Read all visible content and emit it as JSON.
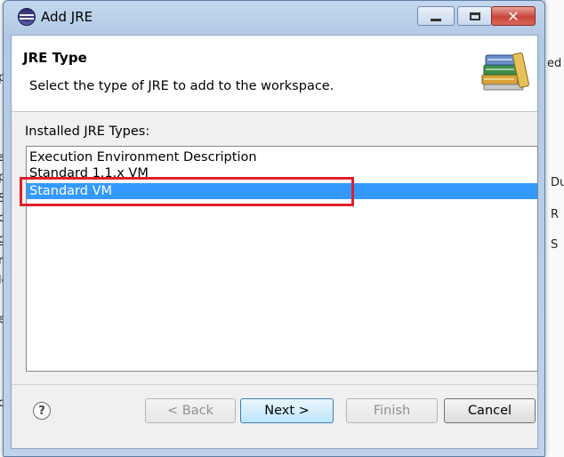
{
  "window": {
    "title": "Add JRE",
    "minimize_label": "",
    "maximize_label": "",
    "close_label": "✕"
  },
  "background": {
    "behind_title": "Installed JREs",
    "left_fragments": [
      "a",
      "p",
      "pl",
      "S",
      "oi",
      "g",
      "r",
      "le",
      "er",
      "o"
    ],
    "right_fragments": [
      "ed",
      "Du",
      "R",
      "S"
    ]
  },
  "header": {
    "title": "JRE Type",
    "description": "Select the type of JRE to add to the workspace.",
    "icon": "books-icon"
  },
  "jre_types": {
    "label": "Installed JRE Types:",
    "items": [
      {
        "label": "Execution Environment Description",
        "selected": false
      },
      {
        "label": "Standard 1.1.x VM",
        "selected": false
      },
      {
        "label": "Standard VM",
        "selected": true
      }
    ]
  },
  "buttons": {
    "help": "?",
    "back": "< Back",
    "next": "Next >",
    "finish": "Finish",
    "cancel": "Cancel"
  },
  "colors": {
    "selection": "#3399ff",
    "highlight_box": "#e0202a"
  }
}
